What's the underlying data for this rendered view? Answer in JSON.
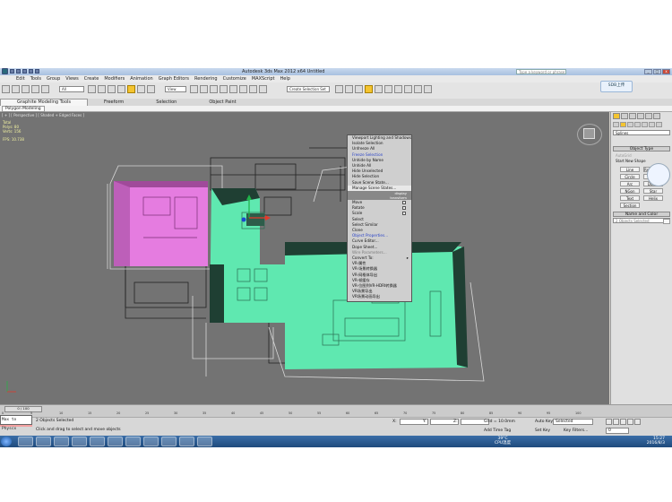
{
  "window": {
    "title": "Autodesk 3ds Max  2012 x64     Untitled",
    "search_placeholder": "Type a keyword or phrase",
    "min": "_",
    "max": "□",
    "close": "x"
  },
  "menu": [
    "Edit",
    "Tools",
    "Group",
    "Views",
    "Create",
    "Modifiers",
    "Animation",
    "Graph Editors",
    "Rendering",
    "Customize",
    "MAXScript",
    "Help"
  ],
  "toolbar": {
    "selection_filter": "All",
    "ref_coord": "View",
    "named_selection": "Create Selection Set"
  },
  "ribbon": {
    "tabs": [
      "Graphite Modeling Tools",
      "Freeform",
      "Selection",
      "Object Paint"
    ],
    "subtab": "Polygon Modeling"
  },
  "viewport": {
    "label": "[ + ] [ Perspective ] [ Shaded + Edged Faces ]",
    "stats": {
      "total": "Total",
      "polys": "Polys: 80",
      "verts": "Verts: 156",
      "fps": "FPS:   10.738"
    }
  },
  "quad_menu": {
    "display": [
      "Viewport Lighting and Shadows",
      "Isolate Selection",
      "Unfreeze All",
      "Freeze Selection",
      "Unhide by Name",
      "Unhide All",
      "Hide Unselected",
      "Hide Selection",
      "Save Scene State...",
      "Manage Scene States..."
    ],
    "display_header": "display",
    "transform_header": "transform",
    "transform": [
      "Move",
      "Rotate",
      "Scale",
      "Select",
      "Select Similar",
      "Clone",
      "Object Properties...",
      "Curve Editor...",
      "Dope Sheet...",
      "Wire Parameters...",
      "Convert To:",
      "VR-属性",
      "VR-场景转换器",
      "VR-网格体导出",
      "VR-帧缓存",
      "VR-位图到VR-HDRI转换器",
      "VR场景导出",
      "VR场景动画导出"
    ]
  },
  "command_panel": {
    "dropdown": "Splines",
    "object_type": "Object Type",
    "autogrid": "AutoGrid",
    "start_new_shape": "Start New Shape",
    "buttons": [
      "Line",
      "Rectangle",
      "Circle",
      "Ellipse",
      "Arc",
      "Donut",
      "NGon",
      "Star",
      "Text",
      "Helix",
      "Section"
    ],
    "name_and_color": "Name and Color",
    "name_value": "2 Objects Selected"
  },
  "timeline": {
    "slider": "0 / 100",
    "ticks": [
      "0",
      "5",
      "10",
      "15",
      "20",
      "25",
      "30",
      "35",
      "40",
      "45",
      "50",
      "55",
      "60",
      "65",
      "70",
      "75",
      "80",
      "85",
      "90",
      "95",
      "100"
    ]
  },
  "status": {
    "maxscript": "",
    "selected": "2 Objects Selected",
    "prompt": "Click and drag to select and move objects",
    "x_label": "X:",
    "y_label": "Y:",
    "z_label": "Z:",
    "grid": "Grid = 10.0mm",
    "auto_key": "Auto Key",
    "auto_key_value": "Selected",
    "set_key": "Set Key",
    "key_filters": "Key Filters...",
    "add_time_tag": "Add Time Tag",
    "frame": "0",
    "input_text": "Max to Physcx"
  },
  "taskbar": {
    "temp": "39°C",
    "cpu": "CPU温度",
    "time": "15:27",
    "date": "2016/8/3"
  },
  "floating_button": "SDB上传",
  "colors": {
    "pink": "#e57ce0",
    "green": "#5fe8b0",
    "dark_green": "#1f3f33",
    "viewport": "#737373",
    "yellow": "#f4c430"
  }
}
